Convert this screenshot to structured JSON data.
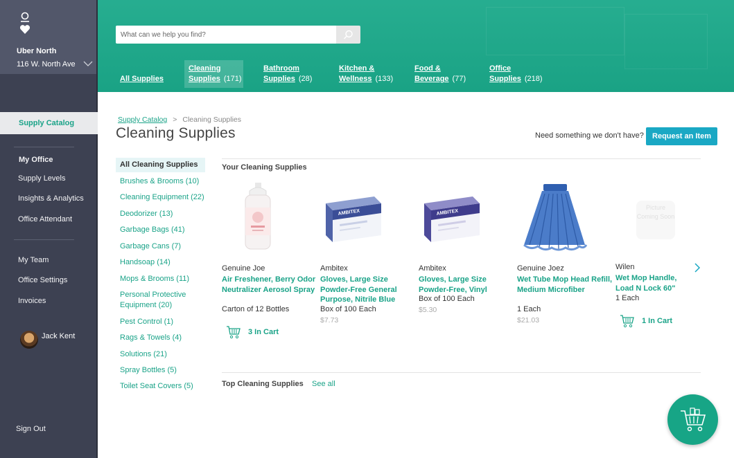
{
  "sidebar": {
    "org_name": "Uber North",
    "org_address": "116 W. North Ave",
    "active_item": "Supply Catalog",
    "section_header": "My Office",
    "office_items": [
      "Supply Levels",
      "Insights & Analytics",
      "Office Attendant"
    ],
    "team_items": [
      "My Team",
      "Office Settings",
      "Invoices"
    ],
    "user_name": "Jack Kent",
    "sign_out": "Sign Out"
  },
  "header": {
    "search_placeholder": "What can we help you find?",
    "tabs": [
      {
        "line1": "All Supplies",
        "line2": "",
        "count": ""
      },
      {
        "line1": "Cleaning",
        "line2": "Supplies",
        "count": "(171)"
      },
      {
        "line1": "Bathroom",
        "line2": "Supplies",
        "count": "(28)"
      },
      {
        "line1": "Kitchen &",
        "line2": "Wellness",
        "count": "(133)"
      },
      {
        "line1": "Food &",
        "line2": "Beverage",
        "count": "(77)"
      },
      {
        "line1": "Office",
        "line2": "Supplies",
        "count": "(218)"
      }
    ]
  },
  "breadcrumb": {
    "link": "Supply Catalog",
    "separator": ">",
    "current": "Cleaning Supplies"
  },
  "page_title": "Cleaning Supplies",
  "request": {
    "prompt": "Need something we don't have?",
    "button": "Request an Item"
  },
  "categories": {
    "active": "All Cleaning Supplies",
    "items": [
      "Brushes & Brooms (10)",
      "Cleaning Equipment (22)",
      "Deodorizer (13)",
      "Garbage Bags (41)",
      "Garbage Cans (7)",
      "Handsoap (14)",
      "Mops & Brooms (11)",
      "Personal Protective Equipment (20)",
      "Pest Control (1)",
      "Rags & Towels (4)",
      "Solutions (21)",
      "Spray Bottles (5)",
      "Toilet Seat Covers (5)"
    ]
  },
  "your_section": {
    "title": "Your Cleaning Supplies",
    "products": [
      {
        "brand": "Genuine Joe",
        "name": "Air Freshener, Berry Odor Neutralizer Aerosol Spray",
        "pack": "Carton of 12 Bottles",
        "price": "",
        "cart": "3 In Cart",
        "image": "aerosol-can"
      },
      {
        "brand": "Ambitex",
        "name": "Gloves, Large Size Powder-Free General Purpose, Nitrile Blue",
        "pack": "Box of 100 Each",
        "price": "$7.73",
        "cart": "",
        "image": "glove-box",
        "box_label": "AMBITEX"
      },
      {
        "brand": "Ambitex",
        "name": "Gloves, Large Size Powder-Free, Vinyl",
        "pack": "Box of 100 Each",
        "price": "$5.30",
        "cart": "",
        "image": "glove-box",
        "box_label": "AMBITEX"
      },
      {
        "brand": "Genuine Joez",
        "name": "Wet Tube Mop Head Refill, Medium Microfiber",
        "pack": "1 Each",
        "price": "$21.03",
        "cart": "",
        "image": "mop-head"
      },
      {
        "brand": "Wilen",
        "name": "Wet Mop Handle, Load N Lock 60\"",
        "pack": "1 Each",
        "price": "",
        "cart": "1 In Cart",
        "image": "picture-placeholder",
        "placeholder_text": "Picture Coming Soon"
      }
    ]
  },
  "top_section": {
    "title": "Top Cleaning Supplies",
    "see_all": "See all"
  },
  "colors": {
    "brand_green": "#1ba98a",
    "link_green": "#1aa388",
    "sidebar": "#3d4152",
    "request_blue": "#1aa8c4"
  }
}
